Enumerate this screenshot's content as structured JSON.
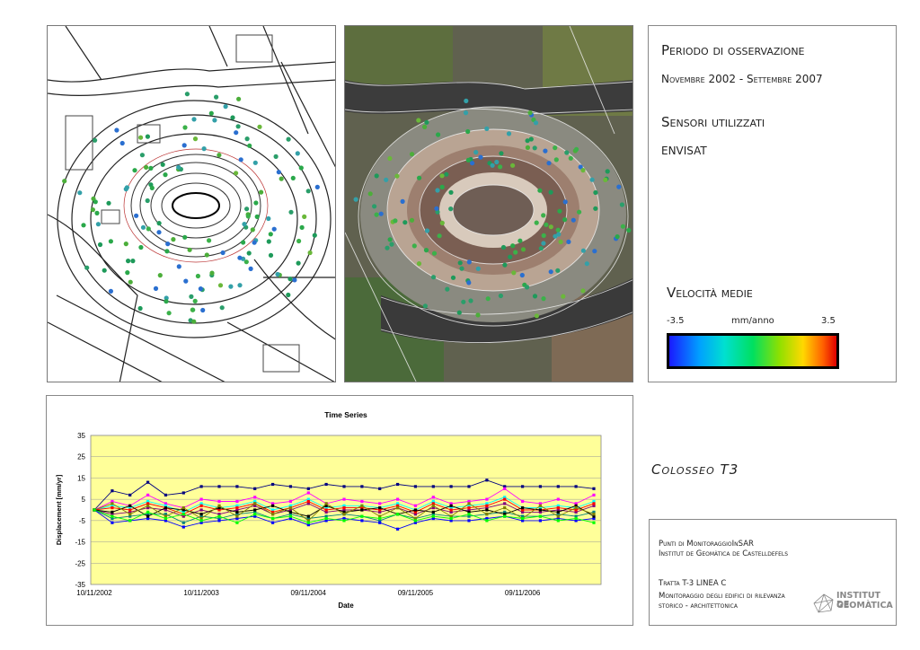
{
  "info": {
    "period_heading": "Periodo di osservazione",
    "period_value": "Novembre 2002 - Settembre 2007",
    "sensors_heading": "Sensori utilizzati",
    "sensors_value": "ENVISAT",
    "velocity_heading": "Velocità medie",
    "scale_min": "-3.5",
    "scale_unit": "mm/anno",
    "scale_max": "3.5"
  },
  "site_title": "Colosseo T3",
  "footer": {
    "line1": "Punti di MonitoraggioInSAR",
    "line2": "Institut de Geomàtica de Castelldefels",
    "line3": "Tratta T-3 LINEA C",
    "line4": "Monitoraggio degli edifici di rilevanza",
    "line5": "storico - architettonica",
    "logo_line1": "INSTITUT DE",
    "logo_line2": "GEOMÀTICA"
  },
  "colors": {
    "plot_bg": "#ffff99",
    "series": [
      "#000080",
      "#ff00ff",
      "#00ffff",
      "#800080",
      "#008080",
      "#0000ff",
      "#ff0000",
      "#000000",
      "#808000",
      "#00ff00"
    ]
  },
  "chart_data": {
    "type": "line",
    "title": "Time Series",
    "xlabel": "Date",
    "ylabel": "Displacement [mm/yr]",
    "ylim": [
      -35,
      35
    ],
    "yticks": [
      "35",
      "25",
      "15",
      "5",
      "-5",
      "-15",
      "-25",
      "-35"
    ],
    "xticks": [
      "10/11/2002",
      "10/11/2003",
      "09/11/2004",
      "09/11/2005",
      "09/11/2006"
    ],
    "x": [
      "2002-11",
      "2003-01",
      "2003-03",
      "2003-05",
      "2003-07",
      "2003-09",
      "2003-11",
      "2004-01",
      "2004-03",
      "2004-05",
      "2004-07",
      "2004-09",
      "2004-11",
      "2005-01",
      "2005-03",
      "2005-05",
      "2005-07",
      "2005-09",
      "2005-11",
      "2006-01",
      "2006-03",
      "2006-05",
      "2006-07",
      "2006-09",
      "2006-11",
      "2007-01",
      "2007-03",
      "2007-05",
      "2007-09"
    ],
    "series": [
      {
        "values": [
          0,
          9,
          7,
          13,
          7,
          8,
          11,
          11,
          11,
          10,
          12,
          11,
          10,
          12,
          11,
          11,
          10,
          12,
          11,
          11,
          11,
          11,
          14,
          11,
          11,
          11,
          11,
          11,
          10
        ]
      },
      {
        "values": [
          0,
          4,
          2,
          7,
          3,
          1,
          5,
          4,
          4,
          6,
          3,
          4,
          8,
          3,
          5,
          4,
          3,
          5,
          2,
          6,
          3,
          4,
          5,
          10,
          4,
          3,
          5,
          3,
          7
        ]
      },
      {
        "values": [
          0,
          2,
          1,
          4,
          2,
          -1,
          3,
          1,
          2,
          4,
          0,
          2,
          5,
          1,
          2,
          2,
          1,
          3,
          0,
          4,
          1,
          2,
          3,
          6,
          1,
          1,
          2,
          1,
          4
        ]
      },
      {
        "values": [
          0,
          -2,
          -1,
          1,
          0,
          -3,
          0,
          -2,
          0,
          2,
          -2,
          0,
          3,
          -1,
          0,
          0,
          -1,
          1,
          -2,
          1,
          -1,
          0,
          1,
          3,
          -1,
          -1,
          0,
          -1,
          2
        ]
      },
      {
        "values": [
          0,
          -4,
          -3,
          -2,
          -2,
          -6,
          -3,
          -4,
          -2,
          -1,
          -4,
          -2,
          -4,
          -3,
          -2,
          -3,
          -5,
          -2,
          -4,
          -2,
          -3,
          -3,
          -2,
          -1,
          -3,
          -3,
          -2,
          -3,
          -1
        ]
      },
      {
        "values": [
          0,
          -6,
          -5,
          -4,
          -5,
          -8,
          -6,
          -5,
          -4,
          -3,
          -6,
          -4,
          -7,
          -5,
          -4,
          -5,
          -6,
          -9,
          -6,
          -4,
          -5,
          -5,
          -4,
          -3,
          -5,
          -5,
          -4,
          -5,
          -4
        ]
      },
      {
        "values": [
          0,
          1,
          0,
          3,
          1,
          -2,
          2,
          0,
          1,
          3,
          -1,
          1,
          4,
          0,
          1,
          1,
          0,
          2,
          -1,
          3,
          0,
          1,
          2,
          5,
          0,
          0,
          1,
          0,
          3
        ]
      },
      {
        "values": [
          0,
          -1,
          2,
          -3,
          1,
          0,
          -2,
          1,
          -1,
          0,
          2,
          -1,
          -3,
          2,
          -1,
          0,
          1,
          -2,
          0,
          -1,
          2,
          -1,
          0,
          -2,
          1,
          0,
          -1,
          2,
          -3
        ]
      },
      {
        "values": [
          0,
          3,
          -2,
          2,
          -3,
          1,
          -4,
          2,
          -3,
          3,
          -2,
          1,
          -5,
          3,
          -2,
          2,
          -3,
          1,
          -4,
          2,
          -3,
          3,
          -2,
          1,
          -4,
          2,
          -3,
          1,
          -2
        ]
      },
      {
        "values": [
          0,
          -3,
          -5,
          -1,
          -4,
          -2,
          -5,
          -3,
          -6,
          -2,
          -4,
          -3,
          -6,
          -4,
          -5,
          -3,
          -4,
          -2,
          -5,
          -3,
          -4,
          -2,
          -5,
          -3,
          -4,
          -3,
          -5,
          -4,
          -6
        ]
      }
    ]
  }
}
